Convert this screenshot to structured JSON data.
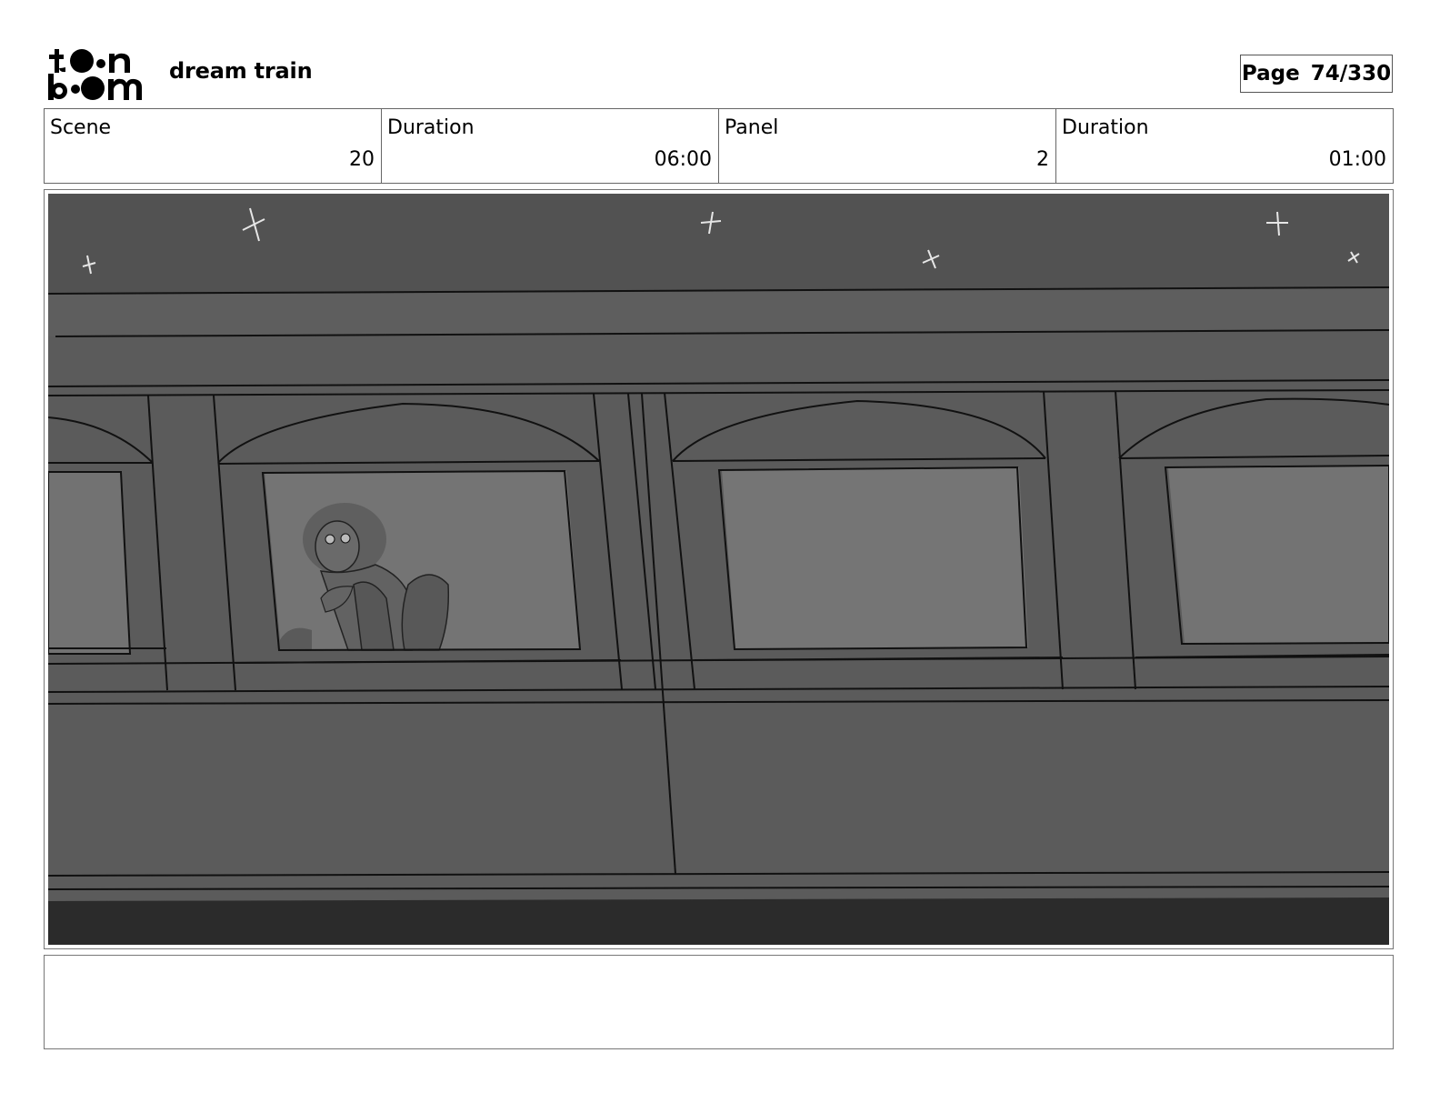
{
  "header": {
    "logo_top": "toon",
    "logo_bottom": "boom",
    "project_title": "dream train",
    "page_label": "Page",
    "page_number": "74/330"
  },
  "info": {
    "scene_label": "Scene",
    "scene_value": "20",
    "scene_duration_label": "Duration",
    "scene_duration_value": "06:00",
    "panel_label": "Panel",
    "panel_value": "2",
    "panel_duration_label": "Duration",
    "panel_duration_value": "01:00"
  },
  "panel_image": {
    "description": "night-train-side-girl-in-window-sketch"
  },
  "notes": {
    "text": ""
  },
  "colors": {
    "sky": "#525252",
    "train_body": "#5b5b5b",
    "window_glass": "#737373",
    "ground": "#2b2b2b",
    "lines": "#111111"
  }
}
